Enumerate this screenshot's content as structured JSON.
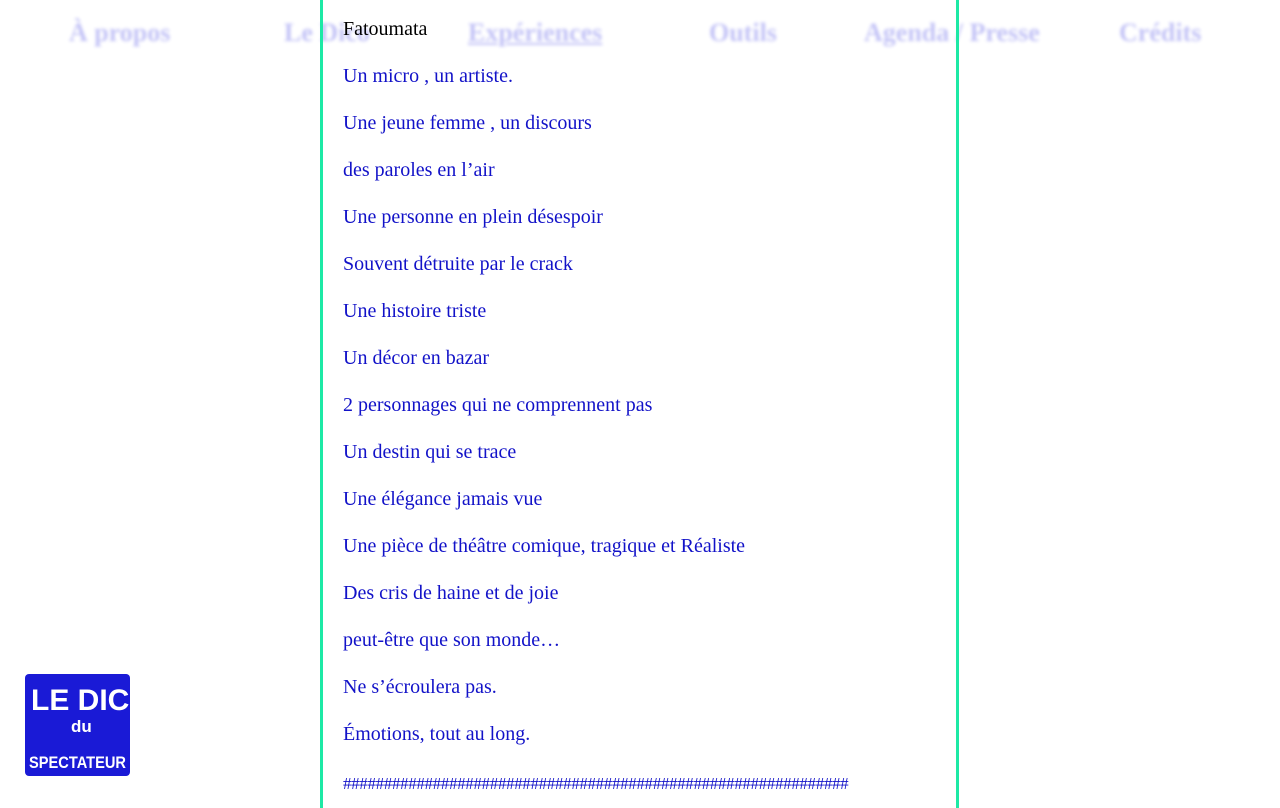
{
  "nav": {
    "items": [
      {
        "label": "À propos"
      },
      {
        "label": "Le Dico"
      },
      {
        "label": "Expériences"
      },
      {
        "label": "Outils"
      },
      {
        "label": "Agenda / Presse"
      },
      {
        "label": "Crédits"
      }
    ],
    "active_index": 2
  },
  "poem": {
    "author": "Fatoumata",
    "lines": [
      "Un micro , un artiste.",
      "Une jeune femme , un discours",
      "des paroles en l’air",
      "Une personne en plein désespoir",
      "Souvent détruite par le crack",
      "Une histoire triste",
      "Un décor en bazar",
      "2 personnages qui ne comprennent pas",
      "Un destin qui se trace",
      "Une élégance jamais vue",
      "Une pièce de théâtre comique, tragique et Réaliste",
      "Des cris de haine et de joie",
      "peut-être que son monde…",
      "Ne s’écroulera pas.",
      "Émotions, tout au long.",
      "##############################################################"
    ]
  },
  "logo": {
    "text_top": "LE DICO",
    "text_mid": "du",
    "text_bottom": "SPECTATEUR",
    "color": "#1a1ad6"
  },
  "colors": {
    "border": "#1de9a5",
    "text": "#1212c8",
    "nav": "#2a2ae0"
  }
}
